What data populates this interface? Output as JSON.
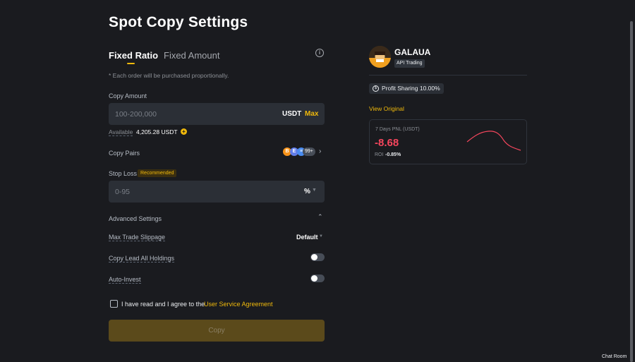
{
  "page": {
    "title": "Spot Copy Settings"
  },
  "tabs": [
    {
      "label": "Fixed Ratio"
    },
    {
      "label": "Fixed Amount"
    }
  ],
  "icons": {
    "info": "info-icon",
    "plus": "plus-circle-icon",
    "chevron_right": "chevron-right-icon",
    "chevron_up": "chevron-up-icon",
    "caret_down": "caret-down-icon"
  },
  "form": {
    "note": "* Each order will be purchased proportionally.",
    "copy_amount": {
      "label": "Copy Amount",
      "placeholder": "100-200,000",
      "unit": "USDT",
      "max_label": "Max"
    },
    "available": {
      "label": "Available",
      "value": "4,205.28 USDT"
    },
    "copy_pairs": {
      "label": "Copy Pairs",
      "coins": [
        "B",
        "E",
        "≡"
      ],
      "count": "99+"
    },
    "stop_loss": {
      "label": "Stop Loss",
      "badge": "Recommended",
      "placeholder": "0-95",
      "unit": "%"
    },
    "advanced": {
      "label": "Advanced Settings"
    },
    "slippage": {
      "label": "Max Trade Slippage",
      "value": "Default"
    },
    "copy_lead": {
      "label": "Copy Lead All Holdings",
      "on": false
    },
    "auto_invest": {
      "label": "Auto-Invest",
      "on": false
    },
    "agreement": {
      "text": "I have read and I agree to the",
      "link": "User Service Agreement"
    },
    "submit": {
      "label": "Copy"
    }
  },
  "trader": {
    "name": "GALAUA",
    "badge": "API Trading",
    "profit_sharing": "Profit Sharing 10.00%",
    "view_original": "View Original",
    "pnl": {
      "label": "7 Days PNL (USDT)",
      "value": "-8.68",
      "roi_label": "ROI",
      "roi_value": "-0.85%"
    }
  },
  "footer": {
    "chat_room": "Chat Room"
  },
  "colors": {
    "accent": "#f0b90b",
    "negative": "#f6465d",
    "background": "#1a1b1f",
    "input": "#2b2f36"
  }
}
